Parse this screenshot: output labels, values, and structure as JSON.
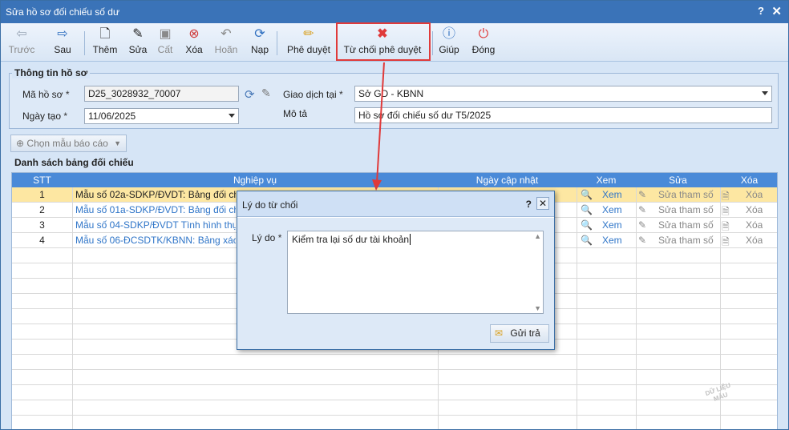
{
  "window": {
    "title": "Sửa hồ sơ đối chiếu số dư",
    "help": "?",
    "close": "✕"
  },
  "toolbar": {
    "prev": "Trước",
    "next": "Sau",
    "add": "Thêm",
    "edit": "Sửa",
    "save": "Cất",
    "delete": "Xóa",
    "undo": "Hoãn",
    "reload": "Nạp",
    "approve": "Phê duyệt",
    "reject": "Từ chối phê duyệt",
    "help": "Giúp",
    "close": "Đóng"
  },
  "info": {
    "group_title": "Thông tin hồ sơ",
    "code_label": "Mã hồ sơ",
    "code_value": "D25_3028932_70007",
    "date_label": "Ngày tạo",
    "date_value": "11/06/2025",
    "trans_label": "Giao dịch tại",
    "trans_value": "Sở GD - KBNN",
    "desc_label": "Mô tả",
    "desc_value": "Hồ sơ đối chiếu số dư T5/2025",
    "required_mark": "*"
  },
  "choose_template": "Chọn mẫu báo cáo",
  "list": {
    "group_title": "Danh sách bảng đối chiếu",
    "columns": [
      "STT",
      "Nghiệp vụ",
      "Ngày cập nhật",
      "Xem",
      "Sửa",
      "Xóa"
    ],
    "rows": [
      {
        "stt": "1",
        "name": "Mẫu số 02a-SDKP/ĐVDT: Bảng đối chiếu",
        "view": "Xem",
        "edit": "Sửa tham số",
        "del": "Xóa"
      },
      {
        "stt": "2",
        "name": "Mẫu số 01a-SDKP/ĐVDT: Bảng đối chiếu",
        "view": "Xem",
        "edit": "Sửa tham số",
        "del": "Xóa"
      },
      {
        "stt": "3",
        "name": "Mẫu số 04-SDKP/ĐVDT Tình hình thực h",
        "view": "Xem",
        "edit": "Sửa tham số",
        "del": "Xóa"
      },
      {
        "stt": "4",
        "name": "Mẫu số 06-ĐCSDTK/KBNN: Bảng xác nh",
        "view": "Xem",
        "edit": "Sửa tham số",
        "del": "Xóa"
      }
    ]
  },
  "dialog": {
    "title": "Lý do từ chối",
    "help": "?",
    "close": "✕",
    "reason_label": "Lý do",
    "required_mark": "*",
    "reason_value": "Kiểm tra lại số dư tài khoản",
    "send": "Gửi trả"
  },
  "watermark": "DỮ LIỆU MẪU",
  "colors": {
    "accent": "#3a73b8",
    "highlight": "#e03a3a",
    "selected_row": "#fde7a2",
    "link": "#2f75c8"
  }
}
